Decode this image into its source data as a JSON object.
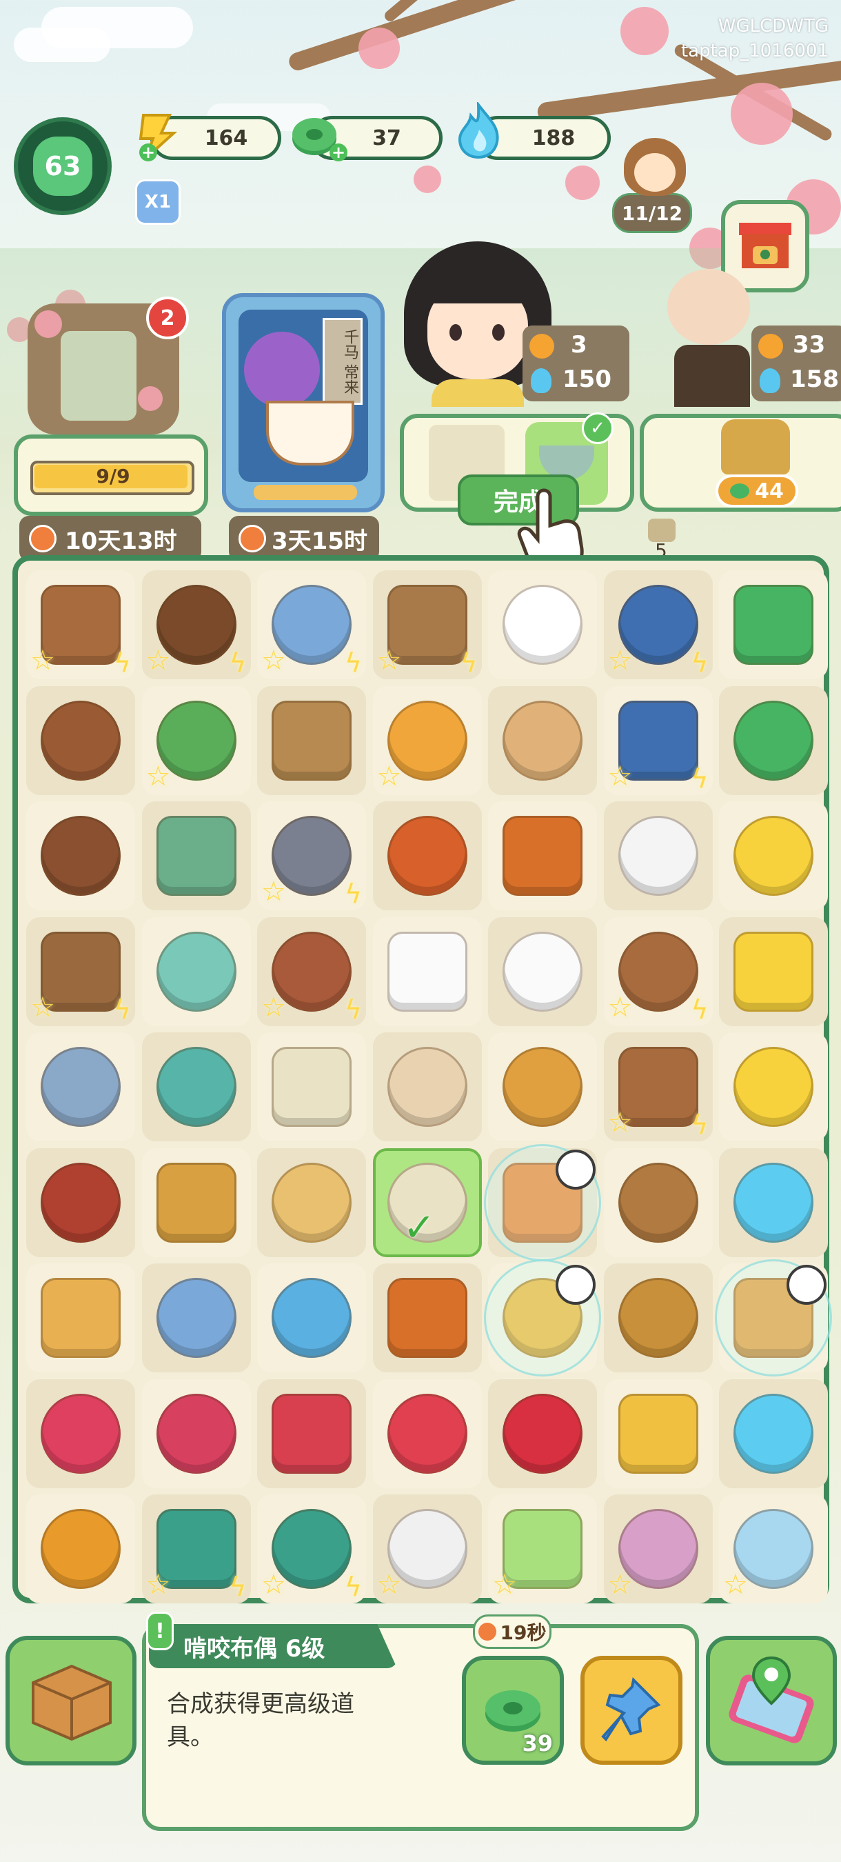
{
  "watermark": {
    "line1": "WGLCDWTG",
    "line2": "taptap_1016001"
  },
  "player": {
    "level": "63",
    "multiplier": "X1"
  },
  "resources": [
    {
      "name": "energy-bolt",
      "value": "164",
      "color": "#ffd23c"
    },
    {
      "name": "jade-coin",
      "value": "37",
      "color": "#47b463"
    },
    {
      "name": "blue-flame",
      "value": "188",
      "color": "#59c7ef"
    }
  ],
  "npc_counter": "11/12",
  "left_building": {
    "badge": "2",
    "progress": "9/9",
    "timer": "10天13时"
  },
  "event_card": {
    "timer": "3天15时",
    "sign_text": "千马 常来"
  },
  "customers": [
    {
      "stars": "3",
      "flames": "150"
    },
    {
      "stars": "33",
      "flames": "158"
    }
  ],
  "order": {
    "complete_button": "完成",
    "reward": "44"
  },
  "hint_count": "5",
  "board": {
    "rows": [
      [
        {
          "icon": "cabinet",
          "star": true,
          "bolt": true
        },
        {
          "icon": "shrine",
          "star": true,
          "bolt": true
        },
        {
          "icon": "house",
          "star": true,
          "bolt": true
        },
        {
          "icon": "cabin",
          "star": true,
          "bolt": true
        },
        {
          "icon": "dog",
          "star": false,
          "bolt": false
        },
        {
          "icon": "book-stand",
          "star": true,
          "bolt": true
        },
        {
          "icon": "jade-stack",
          "star": false,
          "bolt": false
        }
      ],
      [
        {
          "icon": "chair",
          "star": false,
          "bolt": false
        },
        {
          "icon": "herb-bowl",
          "star": true,
          "bolt": false
        },
        {
          "icon": "herb-board",
          "star": false,
          "bolt": false
        },
        {
          "icon": "toy-giraffe",
          "star": true,
          "bolt": false
        },
        {
          "icon": "shiba",
          "star": false,
          "bolt": false
        },
        {
          "icon": "wine-jar",
          "star": true,
          "bolt": true
        },
        {
          "icon": "jade-pair",
          "star": false,
          "bolt": false
        }
      ],
      [
        {
          "icon": "stool",
          "star": false,
          "bolt": false
        },
        {
          "icon": "bowl-greens",
          "star": false,
          "bolt": false
        },
        {
          "icon": "mortar",
          "star": true,
          "bolt": true
        },
        {
          "icon": "meat",
          "star": false,
          "bolt": false
        },
        {
          "icon": "drumstick",
          "star": false,
          "bolt": false
        },
        {
          "icon": "liquor-jar",
          "star": false,
          "bolt": false
        },
        {
          "icon": "gold-bolts",
          "star": false,
          "bolt": false
        }
      ],
      [
        {
          "icon": "toolbox",
          "star": true,
          "bolt": true
        },
        {
          "icon": "flour-bowl",
          "star": false,
          "bolt": false
        },
        {
          "icon": "drawer-box",
          "star": true,
          "bolt": true
        },
        {
          "icon": "white-cat",
          "star": false,
          "bolt": false
        },
        {
          "icon": "puppy",
          "star": false,
          "bolt": false
        },
        {
          "icon": "charm-rack",
          "star": true,
          "bolt": true
        },
        {
          "icon": "gold-bolts-2",
          "star": false,
          "bolt": false
        }
      ],
      [
        {
          "icon": "hammer",
          "star": false,
          "bolt": false
        },
        {
          "icon": "red-bowl",
          "star": false,
          "bolt": false
        },
        {
          "icon": "scroll",
          "star": false,
          "bolt": false
        },
        {
          "icon": "chihuahua",
          "star": false,
          "bolt": false
        },
        {
          "icon": "knot",
          "star": false,
          "bolt": false
        },
        {
          "icon": "charm-rack-2",
          "star": true,
          "bolt": true
        },
        {
          "icon": "bolt",
          "star": false,
          "bolt": false
        }
      ],
      [
        {
          "icon": "firework",
          "star": false,
          "bolt": false
        },
        {
          "icon": "mirror",
          "star": false,
          "bolt": false
        },
        {
          "icon": "herb-plate",
          "star": false,
          "bolt": false
        },
        {
          "icon": "book-check",
          "star": false,
          "bolt": false
        },
        {
          "icon": "carrot",
          "star": false,
          "bolt": false
        },
        {
          "icon": "tag",
          "star": false,
          "bolt": false
        },
        {
          "icon": "blue-flames",
          "star": false,
          "bolt": false
        }
      ],
      [
        {
          "icon": "stand",
          "star": false,
          "bolt": false
        },
        {
          "icon": "painting",
          "star": false,
          "bolt": false
        },
        {
          "icon": "hairpin",
          "star": false,
          "bolt": false
        },
        {
          "icon": "drumstick-2",
          "star": false,
          "bolt": false
        },
        {
          "icon": "pineapple",
          "star": false,
          "bolt": false
        },
        {
          "icon": "tablet",
          "star": false,
          "bolt": false
        },
        {
          "icon": "mooncake",
          "star": false,
          "bolt": false
        }
      ],
      [
        {
          "icon": "tassel",
          "star": false,
          "bolt": false
        },
        {
          "icon": "comb",
          "star": false,
          "bolt": false
        },
        {
          "icon": "bracelet",
          "star": false,
          "bolt": false
        },
        {
          "icon": "red-pouch",
          "star": false,
          "bolt": false
        },
        {
          "icon": "red-flower",
          "star": false,
          "bolt": false
        },
        {
          "icon": "jade-bangle",
          "star": false,
          "bolt": false
        },
        {
          "icon": "flame",
          "star": false,
          "bolt": false
        }
      ],
      [
        {
          "icon": "honey-pot",
          "star": false,
          "bolt": false
        },
        {
          "icon": "gift-bag",
          "star": true,
          "bolt": true
        },
        {
          "icon": "gift-bag-2",
          "star": true,
          "bolt": true
        },
        {
          "icon": "face-mask",
          "star": true,
          "bolt": false
        },
        {
          "icon": "fruit-cup",
          "star": true,
          "bolt": false
        },
        {
          "icon": "cake",
          "star": true,
          "bolt": false
        },
        {
          "icon": "snow-globe",
          "star": true,
          "bolt": false
        }
      ]
    ]
  },
  "bottom": {
    "item_title": "啃咬布偶 6级",
    "item_desc_line1": "合成获得更高级道",
    "item_desc_line2": "具。",
    "sell_timer": "19秒",
    "sell_price": "39"
  }
}
